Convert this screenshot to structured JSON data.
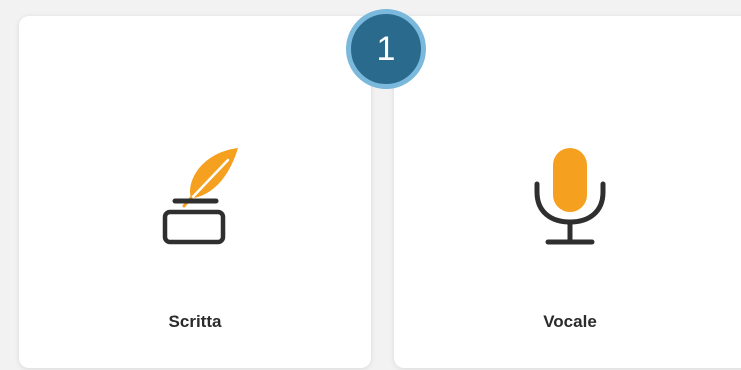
{
  "step": {
    "number": "1"
  },
  "options": [
    {
      "label": "Scritta",
      "icon": "quill-inkwell-icon"
    },
    {
      "label": "Vocale",
      "icon": "microphone-icon"
    }
  ],
  "colors": {
    "accent": "#F5A01E",
    "icon_dark": "#2F2F2F",
    "badge_fill": "#2A6A8D",
    "badge_ring": "#7AB8DC"
  }
}
